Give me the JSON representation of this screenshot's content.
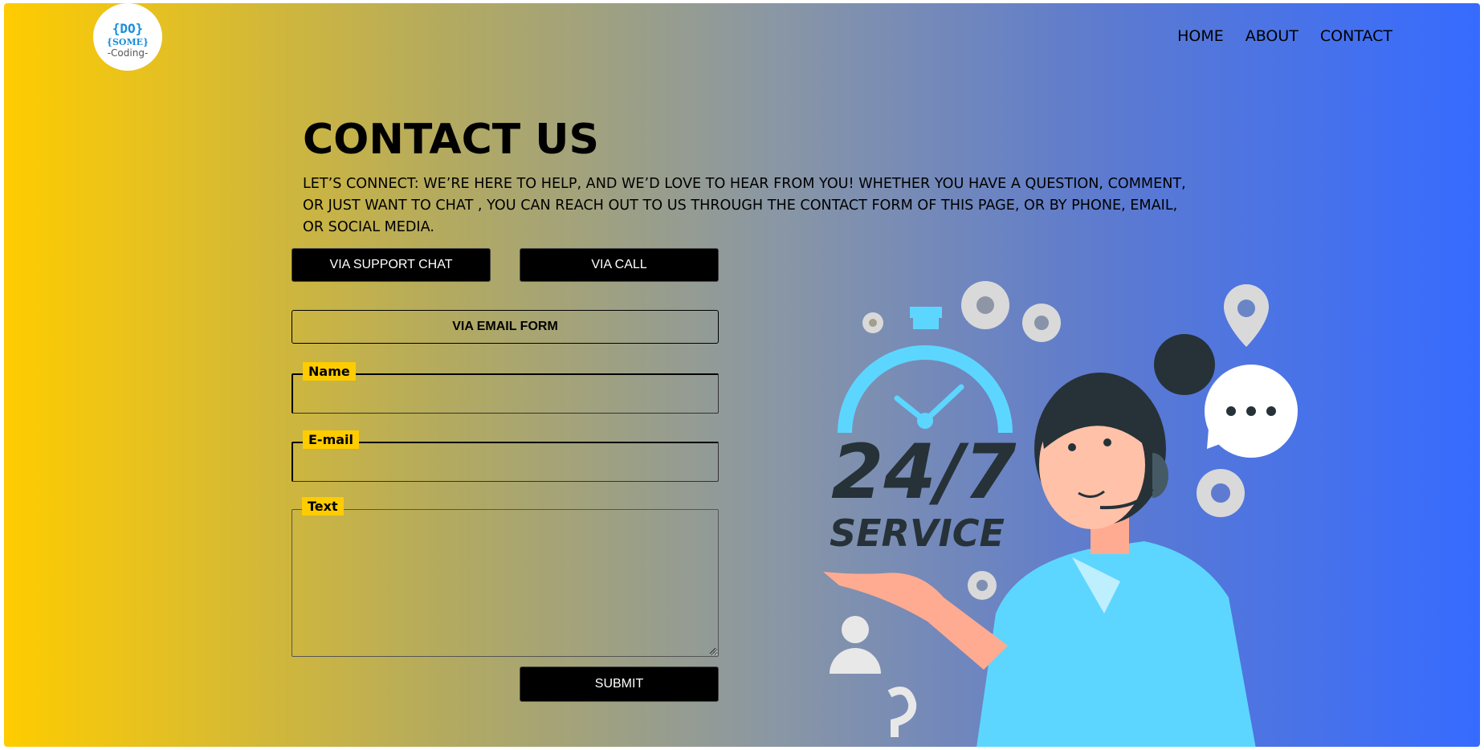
{
  "logo": {
    "top": "{DO}",
    "middle": "{SOME}",
    "bottom": "-Coding-"
  },
  "nav": {
    "items": [
      "HOME",
      "ABOUT",
      "CONTACT"
    ]
  },
  "main": {
    "title": "CONTACT US",
    "description": "LET’S CONNECT: WE’RE HERE TO HELP, AND WE’D LOVE TO HEAR FROM YOU! WHETHER YOU HAVE A QUESTION, COMMENT, OR JUST WANT TO CHAT , YOU CAN REACH OUT TO US THROUGH THE CONTACT FORM OF THIS PAGE, OR BY PHONE, EMAIL, OR SOCIAL MEDIA."
  },
  "buttons": {
    "support_chat": "VIA SUPPORT CHAT",
    "call": "VIA CALL",
    "email_form": "VIA EMAIL FORM",
    "submit": "SUBMIT"
  },
  "form": {
    "name_label": "Name",
    "email_label": "E-mail",
    "text_label": "Text",
    "name_value": "",
    "email_value": "",
    "text_value": ""
  },
  "illustration": {
    "headline": "24/7",
    "subline": "SERVICE"
  },
  "colors": {
    "gradient_start": "#ffcc00",
    "gradient_end": "#366bff",
    "label_bg": "#ffcc00",
    "accent_blue": "#5dd6ff"
  }
}
